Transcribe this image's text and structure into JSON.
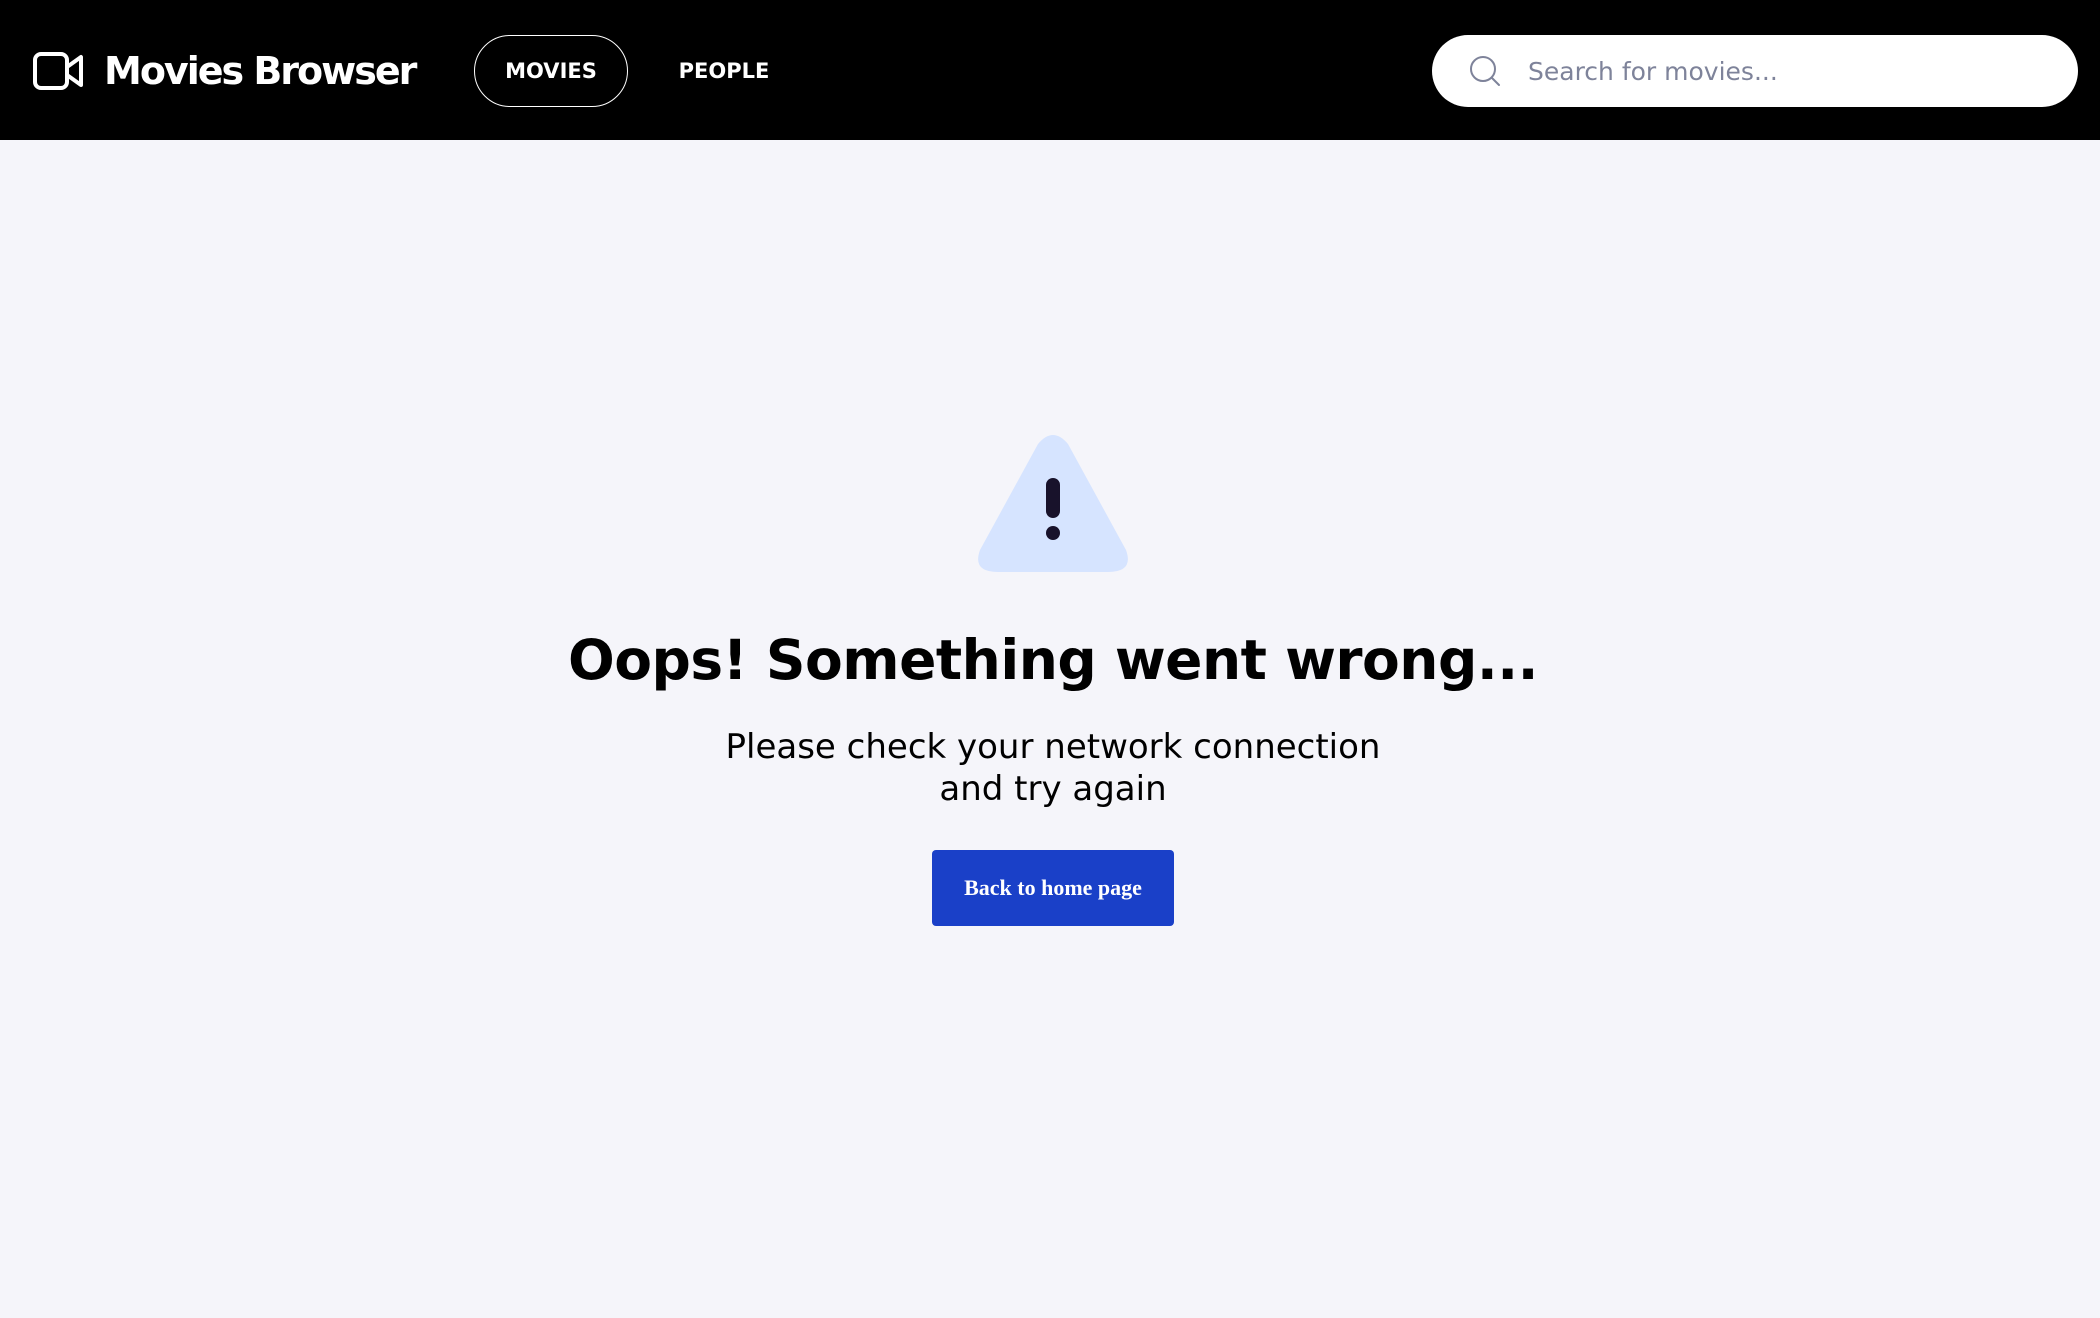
{
  "header": {
    "app_title": "Movies Browser",
    "logo_icon": "video-camera-icon",
    "nav": {
      "movies_label": "MOVIES",
      "people_label": "PEOPLE",
      "active": "MOVIES"
    },
    "search": {
      "placeholder": "Search for movies...",
      "value": "",
      "icon": "search-icon"
    }
  },
  "error": {
    "icon": "warning-triangle-icon",
    "title": "Oops! Something went wrong...",
    "message_line1": "Please check your network connection",
    "message_line2": "and try again",
    "button_label": "Back to home page"
  },
  "colors": {
    "header_bg": "#000000",
    "page_bg": "#f5f5fa",
    "button_bg": "#1a40c8",
    "warning_fill": "#d6e4ff",
    "warning_mark": "#18122b"
  }
}
